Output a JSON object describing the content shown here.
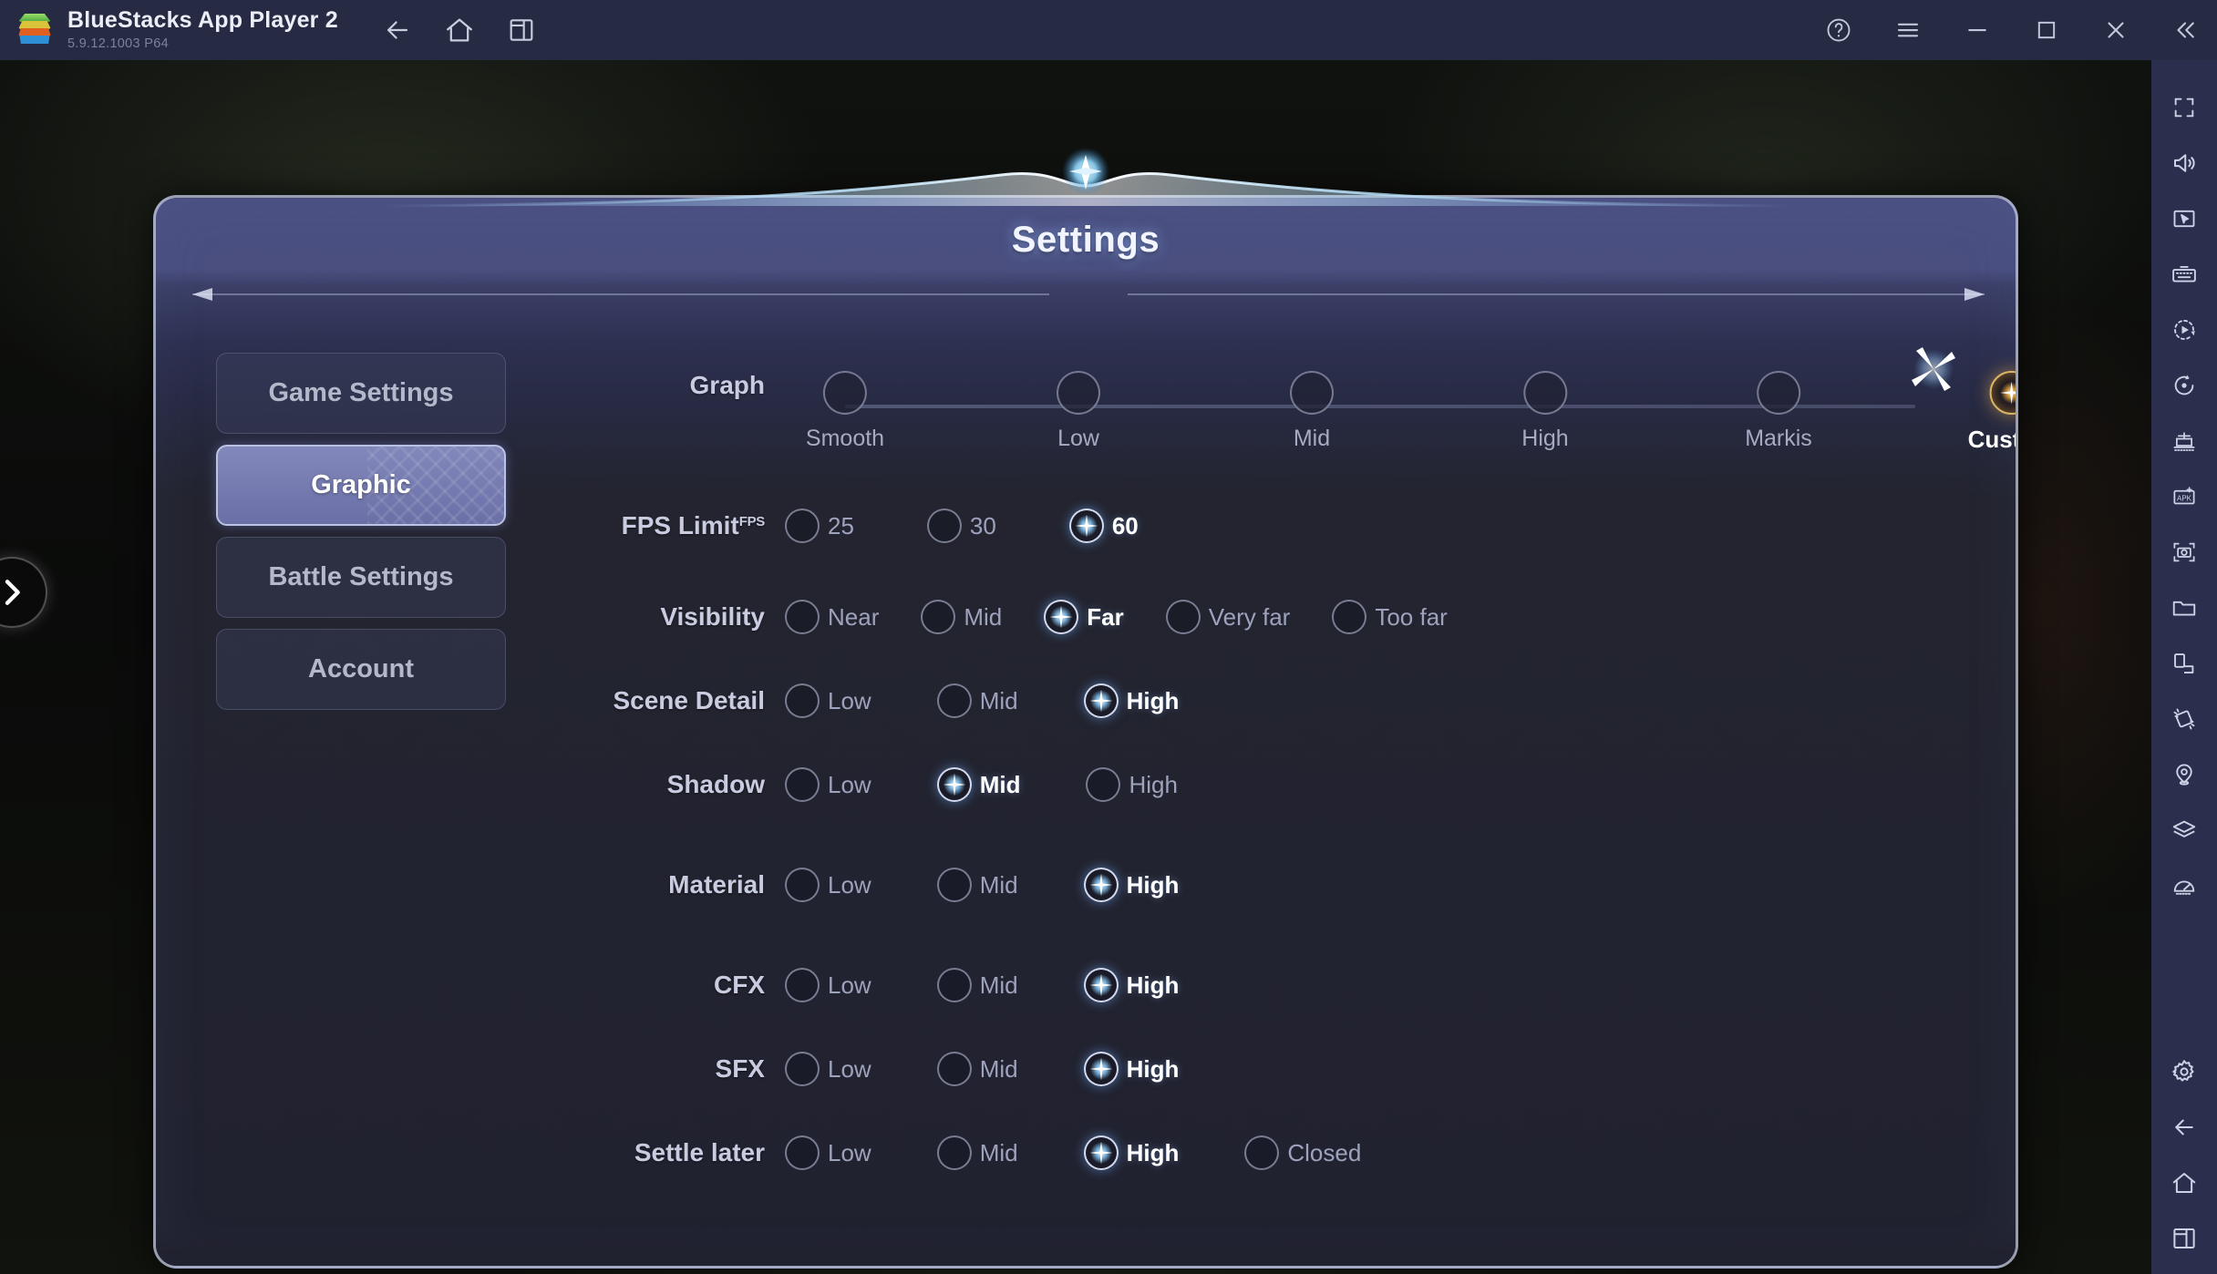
{
  "titlebar": {
    "app_name": "BlueStacks App Player 2",
    "version": "5.9.12.1003  P64",
    "logo_icon": "bluestacks-logo-icon",
    "nav": [
      {
        "name": "back-button",
        "icon": "arrow-left-icon"
      },
      {
        "name": "home-button",
        "icon": "home-icon"
      },
      {
        "name": "multi-instance-button",
        "icon": "windows-stack-icon"
      }
    ],
    "window_controls": [
      {
        "name": "help-button",
        "icon": "question-circle-icon"
      },
      {
        "name": "menu-button",
        "icon": "hamburger-menu-icon"
      },
      {
        "name": "minimize-button",
        "icon": "minimize-icon"
      },
      {
        "name": "maximize-button",
        "icon": "maximize-square-icon"
      },
      {
        "name": "close-button",
        "icon": "close-x-icon"
      },
      {
        "name": "collapse-sidebar-button",
        "icon": "chevron-double-left-icon"
      }
    ]
  },
  "sidebar_rail": {
    "items": [
      {
        "name": "fullscreen-button",
        "icon": "fullscreen-corners-icon"
      },
      {
        "name": "volume-button",
        "icon": "speaker-volume-icon"
      },
      {
        "name": "cursor-control-button",
        "icon": "pointer-in-frame-icon"
      },
      {
        "name": "keymapping-button",
        "icon": "keyboard-icon"
      },
      {
        "name": "macro-recorder-button",
        "icon": "play-record-circle-icon"
      },
      {
        "name": "script-button",
        "icon": "dot-rotate-circle-icon"
      },
      {
        "name": "multi-instance-manager-button",
        "icon": "instance-manager-icon"
      },
      {
        "name": "install-apk-button",
        "icon": "apk-plus-icon"
      },
      {
        "name": "screenshot-button",
        "icon": "camera-frame-icon"
      },
      {
        "name": "media-manager-button",
        "icon": "folder-icon"
      },
      {
        "name": "rotate-screen-button",
        "icon": "rotate-window-icon"
      },
      {
        "name": "shake-button",
        "icon": "shake-device-icon"
      },
      {
        "name": "location-button",
        "icon": "location-pin-icon"
      },
      {
        "name": "layers-button",
        "icon": "layers-stack-icon"
      },
      {
        "name": "performance-button",
        "icon": "speedometer-icon"
      },
      {
        "name": "settings-button",
        "icon": "gear-icon"
      },
      {
        "name": "back-nav-button",
        "icon": "arrow-left-icon"
      },
      {
        "name": "home-nav-button",
        "icon": "home-icon"
      },
      {
        "name": "recents-nav-button",
        "icon": "recent-apps-icon"
      }
    ]
  },
  "game": {
    "expand_arrow_icon": "chevron-right-icon"
  },
  "dialog": {
    "title": "Settings",
    "close_icon": "sparkle-close-icon",
    "tabs": [
      {
        "label": "Game Settings",
        "active": false
      },
      {
        "label": "Graphic",
        "active": true
      },
      {
        "label": "Battle Settings",
        "active": false
      },
      {
        "label": "Account",
        "active": false
      }
    ],
    "rows": [
      {
        "type": "slider",
        "label": "Graph",
        "label_sup": "",
        "options": [
          "Smooth",
          "Low",
          "Mid",
          "High",
          "Markis",
          "Custom"
        ],
        "selected": "Custom",
        "selected_color": "#e9a93c"
      },
      {
        "type": "radio",
        "label": "FPS Limit",
        "label_sup": "FPS",
        "options": [
          "25",
          "30",
          "60"
        ],
        "selected": "60",
        "gap": 80,
        "selected_color": "#8fd0ff"
      },
      {
        "type": "radio",
        "label": "Visibility",
        "label_sup": "",
        "options": [
          "Near",
          "Mid",
          "Far",
          "Very far",
          "Too far"
        ],
        "selected": "Far",
        "gap": 46,
        "selected_color": "#8fd0ff"
      },
      {
        "type": "radio",
        "label": "Scene Detail",
        "label_sup": "",
        "options": [
          "Low",
          "Mid",
          "High"
        ],
        "selected": "High",
        "gap": 72,
        "selected_color": "#8fd0ff"
      },
      {
        "type": "radio",
        "label": "Shadow",
        "label_sup": "",
        "options": [
          "Low",
          "Mid",
          "High"
        ],
        "selected": "Mid",
        "gap": 72,
        "selected_color": "#8fd0ff"
      },
      {
        "type": "radio",
        "label": "Material",
        "label_sup": "",
        "options": [
          "Low",
          "Mid",
          "High"
        ],
        "selected": "High",
        "gap": 72,
        "selected_color": "#8fd0ff"
      },
      {
        "type": "radio",
        "label": "CFX",
        "label_sup": "",
        "options": [
          "Low",
          "Mid",
          "High"
        ],
        "selected": "High",
        "gap": 72,
        "selected_color": "#8fd0ff"
      },
      {
        "type": "radio",
        "label": "SFX",
        "label_sup": "",
        "options": [
          "Low",
          "Mid",
          "High"
        ],
        "selected": "High",
        "gap": 72,
        "selected_color": "#8fd0ff"
      },
      {
        "type": "radio",
        "label": "Settle later",
        "label_sup": "",
        "options": [
          "Low",
          "Mid",
          "High",
          "Closed"
        ],
        "selected": "High",
        "gap": 72,
        "selected_color": "#8fd0ff"
      }
    ]
  },
  "colors": {
    "titlebar_bg": "#262a43",
    "rail_bg": "#2b2f4d",
    "dialog_top": "#4b5082",
    "dialog_body": "#212230",
    "accent_gold": "#e9a93c",
    "accent_blue": "#8fd0ff",
    "tab_active_bg": "#7c82b4"
  }
}
